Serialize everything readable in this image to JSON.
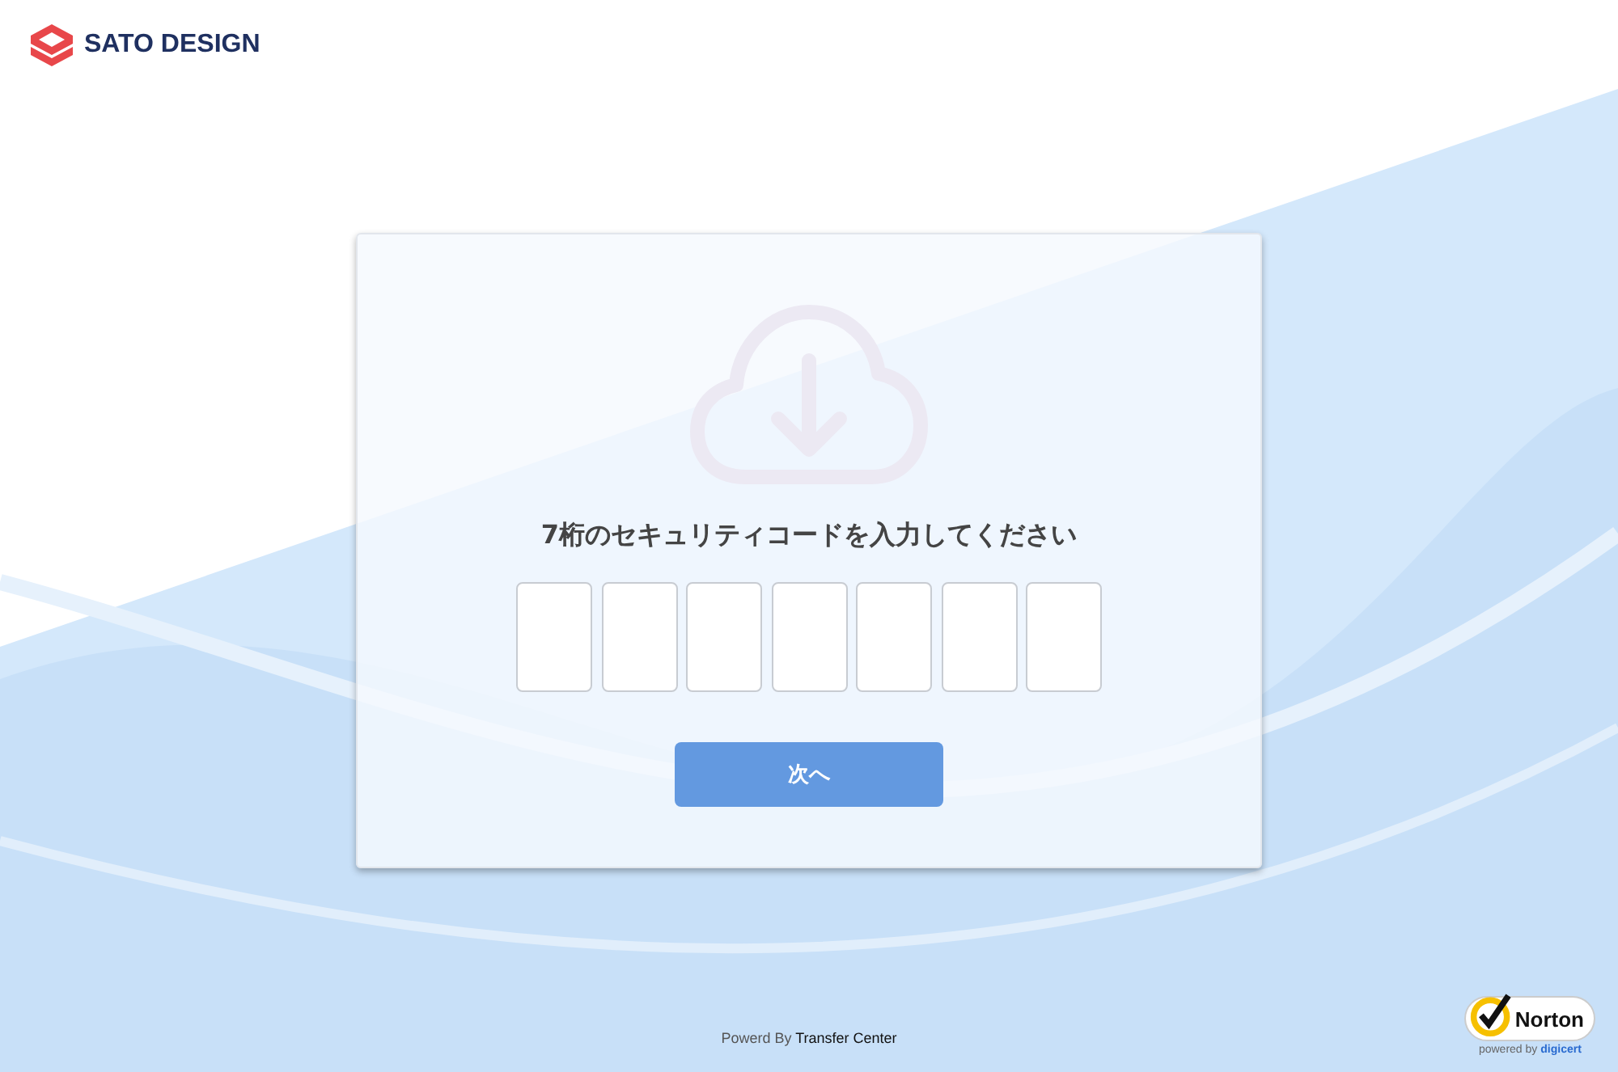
{
  "header": {
    "brand": "SATO DESIGN"
  },
  "card": {
    "title": "7桁のセキュリティコードを入力してください",
    "code_fields": [
      {
        "kind": "digit"
      },
      {
        "kind": "digit"
      },
      {
        "kind": "digit"
      },
      {
        "kind": "digit"
      },
      {
        "kind": "digit"
      },
      {
        "kind": "digit"
      },
      {
        "kind": "digit"
      }
    ],
    "button": "次へ"
  },
  "footer": {
    "text": "Powerd By **Transfer Center**"
  },
  "badge": {
    "name": "Norton",
    "powered": "powered by",
    "by": "digicert"
  }
}
